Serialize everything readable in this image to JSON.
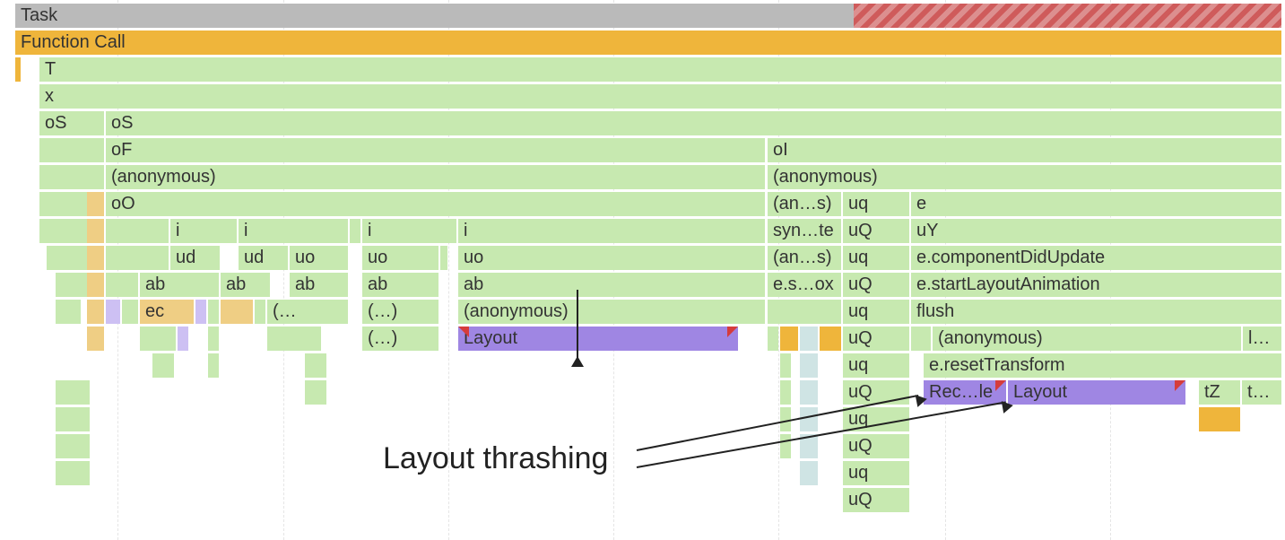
{
  "task_bar": {
    "label": "Task"
  },
  "function_call": {
    "label": "Function Call"
  },
  "rows": {
    "r2": {
      "a": "T"
    },
    "r3": {
      "a": "x"
    },
    "r4": {
      "a": "oS",
      "b": "oS"
    },
    "r5": {
      "a": "oF",
      "b": "oI"
    },
    "r6": {
      "a": "(anonymous)",
      "b": "(anonymous)"
    },
    "r7": {
      "a": "oO",
      "b": "(an…s)",
      "c": "uq",
      "d": "e"
    },
    "r8": {
      "a": "i",
      "b": "i",
      "c": "i",
      "d": "i",
      "e": "syn…te",
      "f": "uQ",
      "g": "uY"
    },
    "r9": {
      "a": "ud",
      "b": "ud",
      "c": "uo",
      "d": "uo",
      "e": "uo",
      "f": "(an…s)",
      "g": "uq",
      "h": "e.componentDidUpdate"
    },
    "r10": {
      "a": "ab",
      "b": "ab",
      "c": "ab",
      "d": "ab",
      "e": "ab",
      "f": "e.s…ox",
      "g": "uQ",
      "h": "e.startLayoutAnimation"
    },
    "r11": {
      "a": "ec",
      "b": "(…",
      "c": "(…)",
      "d": "(anonymous)",
      "e": "uq",
      "f": "flush"
    },
    "r12": {
      "a": "(…)",
      "b": "Layout",
      "c": "uQ",
      "d": "(anonymous)",
      "e": "l…"
    },
    "r13": {
      "a": "uq",
      "b": "e.resetTransform"
    },
    "r14": {
      "a": "uQ",
      "b": "Rec…le",
      "c": "Layout",
      "d": "tZ",
      "e": "t…"
    },
    "r15": {
      "a": "uq"
    },
    "r16": {
      "a": "uQ"
    },
    "r17": {
      "a": "uq"
    },
    "r18": {
      "a": "uQ"
    }
  },
  "annotation": {
    "text": "Layout thrashing"
  }
}
